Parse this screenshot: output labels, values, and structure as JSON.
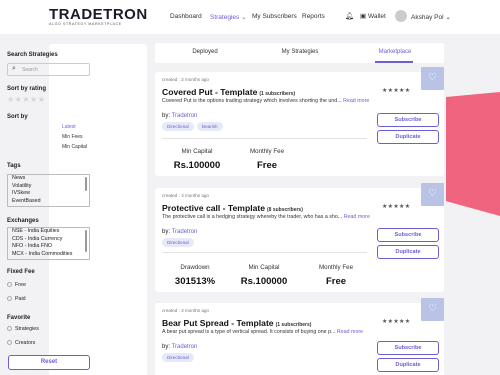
{
  "header": {
    "logo": "TRADETRON",
    "logo_tagline": "ALGO STRATEGY MARKETPLACE",
    "nav": [
      "Dashboard",
      "Strategies ⌄",
      "My Subscribers",
      "Reports"
    ],
    "wallet": "Wallet",
    "user": "Akshay Pol ⌄",
    "accent": "#6b5fd6"
  },
  "sidebar": {
    "search_title": "Search Strategies",
    "search_placeholder": "Search",
    "rating_title": "Sort by rating",
    "sort_title": "Sort by",
    "sort_options": [
      "Latest",
      "Min Fees",
      "Min Capital"
    ],
    "tags_title": "Tags",
    "tags": [
      "News",
      "Volatility",
      "IVSkew",
      "EventBased"
    ],
    "exchanges_title": "Exchanges",
    "exchanges": [
      "NSE - India Equities",
      "CDS - India Currency",
      "NFO - India FNO",
      "MCX - India Commodities"
    ],
    "fixed_fee_title": "Fixed Fee",
    "fixed_fee_options": [
      "Free",
      "Paid"
    ],
    "favorite_title": "Favorite",
    "favorite_options": [
      "Strategies",
      "Creators"
    ],
    "reset_label": "Reset"
  },
  "tabs": [
    "Deployed",
    "My Strategies",
    "Marketplace"
  ],
  "cards": [
    {
      "created": "created : 3 months ago",
      "name": "Covered Put - Template",
      "subscribers": "(1 subscribers)",
      "description": "Covered Put is the options trading strategy which involves shorting the und...",
      "read_more": "Read more",
      "by_label": "by:",
      "creator": "Tradetron",
      "badges": [
        "Directional",
        "Bearish"
      ],
      "subscribe": "Subscribe",
      "duplicate": "Duplicate",
      "metrics": [
        {
          "label": "Min Capital",
          "value": "Rs.100000"
        },
        {
          "label": "Monthly Fee",
          "value": "Free"
        }
      ]
    },
    {
      "created": "created : 3 months ago",
      "name": "Protective call - Template",
      "subscribers": "(8 subscribers)",
      "description": "The protective call is a hedging strategy whereby the trader, who has a sho...",
      "read_more": "Read more",
      "by_label": "by:",
      "creator": "Tradetron",
      "badges": [
        "Directional"
      ],
      "subscribe": "Subscribe",
      "duplicate": "Duplicate",
      "metrics": [
        {
          "label": "Drawdown",
          "value": "301513%"
        },
        {
          "label": "Min Capital",
          "value": "Rs.100000"
        },
        {
          "label": "Monthly Fee",
          "value": "Free"
        }
      ]
    },
    {
      "created": "created : 3 months ago",
      "name": "Bear Put Spread - Template",
      "subscribers": "(1 subscribers)",
      "description": "A bear put spread is a type of vertical spread. It consists of buying one p...",
      "read_more": "Read more",
      "by_label": "by:",
      "creator": "Tradetron",
      "badges": [
        "Directional"
      ],
      "subscribe": "Subscribe",
      "duplicate": "Duplicate"
    }
  ]
}
